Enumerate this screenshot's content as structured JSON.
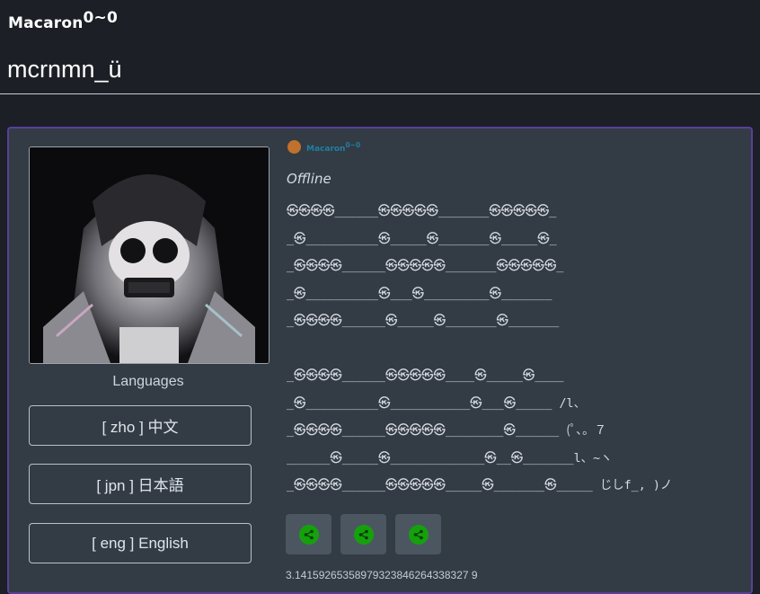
{
  "header": {
    "display_name": "Macaron",
    "display_name_suffix": "0~0",
    "username": "mcrnmn_ü"
  },
  "profile": {
    "avatar_alt": "profile avatar",
    "small_name": "Macaron",
    "small_name_suffix": "0~0",
    "status": "Offline",
    "status_dot_color": "#c0712d",
    "bio_lines": [
      "㉿㉿㉿㉿______㉿㉿㉿㉿㉿_______㉿㉿㉿㉿㉿_",
      "_㉿__________㉿_____㉿_______㉿_____㉿_",
      "_㉿㉿㉿㉿______㉿㉿㉿㉿㉿_______㉿㉿㉿㉿㉿_",
      "_㉿__________㉿___㉿_________㉿_______",
      "_㉿㉿㉿㉿______㉿_____㉿_______㉿_______",
      "",
      "_㉿㉿㉿㉿______㉿㉿㉿㉿㉿____㉿_____㉿____",
      "_㉿__________㉿___________㉿___㉿_____ /l、",
      "_㉿㉿㉿㉿______㉿㉿㉿㉿㉿________㉿______ (ﾟ､。７",
      "______㉿_____㉿_____________㉿__㉿_______l、~ヽ",
      "_㉿㉿㉿㉿______㉿㉿㉿㉿㉿_____㉿_______㉿_____ じしf_, )ノ"
    ],
    "share_buttons": [
      "share",
      "share",
      "share"
    ],
    "share_color": "#14a10c",
    "footer_number": "3.14159265358979323846264338327 9"
  },
  "languages": {
    "title": "Languages",
    "items": [
      {
        "label": "[ zho ] 中文"
      },
      {
        "label": "[ jpn ] 日本語"
      },
      {
        "label": "[ eng ] English"
      }
    ]
  }
}
